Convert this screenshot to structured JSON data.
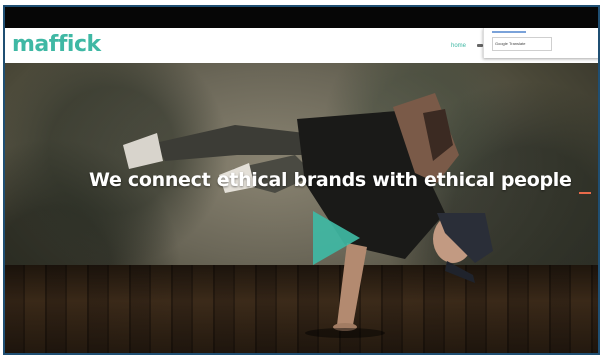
{
  "header": {
    "logo": "maffick",
    "nav_home": "home"
  },
  "dropdown": {
    "field_text": "Google Translate"
  },
  "hero": {
    "headline": "We connect ethical brands with ethical people"
  },
  "colors": {
    "brand": "#3fb8a4",
    "accent": "#e86a4a"
  },
  "icons": {
    "play": "play-icon",
    "more": "more-icon"
  }
}
